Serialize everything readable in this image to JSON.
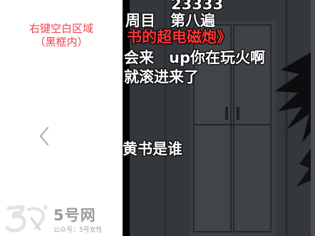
{
  "sidebar": {
    "note_line1": "右键空白区域",
    "note_line2": "（黑框内）",
    "back_icon": "chevron-left-icon"
  },
  "watermark": {
    "name": "5号网",
    "subtitle": "公众号：5号女性"
  },
  "video": {
    "danmaku": {
      "count": "23333",
      "lap": "周目　第八遍",
      "title": "书的超电磁炮》",
      "fire": "会来　up你在玩火啊",
      "roll": "就滚进来了",
      "who": "黄书是谁"
    }
  },
  "colors": {
    "note": "#e8454b",
    "danmaku_red": "#ff3535",
    "danmaku_white": "#ffffff",
    "video_bg": "#2f3236"
  }
}
